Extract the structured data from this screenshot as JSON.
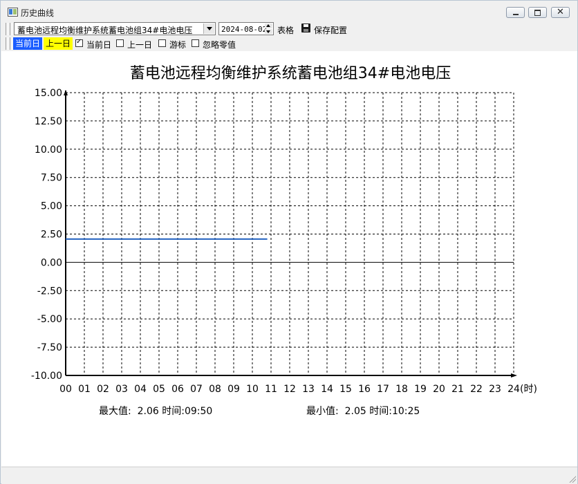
{
  "window": {
    "title": "历史曲线",
    "minimize_icon": "minimize-icon",
    "maximize_icon": "maximize-icon",
    "close_glyph": "✕"
  },
  "toolbar": {
    "series_select": "蓄电池远程均衡维护系统蓄电池组34#电池电压",
    "date_value": "2024-08-02",
    "table_label": "表格",
    "save_label": "保存配置"
  },
  "day_bar": {
    "current_day_tab": "当前日",
    "previous_day_tab": "上一日",
    "current_day_check": "当前日",
    "previous_day_check": "上一日",
    "cursor_check": "游标",
    "ignore_zero_check": "忽略零值",
    "checks": {
      "current_day": true,
      "previous_day": false,
      "cursor": false,
      "ignore_zero": false
    }
  },
  "stats": {
    "max_text": "最大值:  2.06 时间:09:50",
    "min_text": "最小值:  2.05 时间:10:25"
  },
  "colors": {
    "series_line": "#1f5fbf",
    "current_day_tab_bg": "#1a5cff",
    "previous_day_tab_bg": "#ffff00"
  },
  "chart_data": {
    "type": "line",
    "title": "蓄电池远程均衡维护系统蓄电池组34#电池电压",
    "xlabel": "",
    "ylabel": "",
    "x_unit_label": "(时)",
    "xlim": [
      0,
      24
    ],
    "ylim": [
      -10,
      15
    ],
    "x_ticks": [
      0,
      1,
      2,
      3,
      4,
      5,
      6,
      7,
      8,
      9,
      10,
      11,
      12,
      13,
      14,
      15,
      16,
      17,
      18,
      19,
      20,
      21,
      22,
      23,
      24
    ],
    "x_tick_labels": [
      "00",
      "01",
      "02",
      "03",
      "04",
      "05",
      "06",
      "07",
      "08",
      "09",
      "10",
      "11",
      "12",
      "13",
      "14",
      "15",
      "16",
      "17",
      "18",
      "19",
      "20",
      "21",
      "22",
      "23",
      "24"
    ],
    "y_ticks": [
      -10,
      -7.5,
      -5,
      -2.5,
      0,
      2.5,
      5,
      7.5,
      10,
      12.5,
      15
    ],
    "y_tick_labels": [
      "-10.00",
      "-7.50",
      "-5.00",
      "-2.50",
      "0.00",
      "2.50",
      "5.00",
      "7.50",
      "10.00",
      "12.50",
      "15.00"
    ],
    "grid": true,
    "series": [
      {
        "x": [
          0,
          10.8
        ],
        "y": [
          2.06,
          2.06
        ]
      }
    ]
  }
}
